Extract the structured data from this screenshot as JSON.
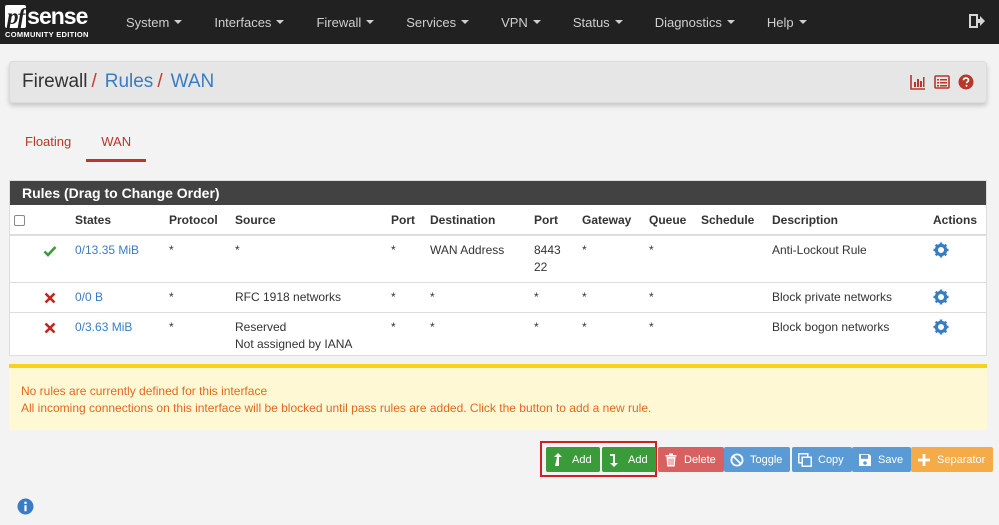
{
  "brand": {
    "logo_pf": "pf",
    "logo_sense": "sense",
    "edition": "COMMUNITY EDITION"
  },
  "nav": [
    {
      "label": "System"
    },
    {
      "label": "Interfaces"
    },
    {
      "label": "Firewall"
    },
    {
      "label": "Services"
    },
    {
      "label": "VPN"
    },
    {
      "label": "Status"
    },
    {
      "label": "Diagnostics"
    },
    {
      "label": "Help"
    }
  ],
  "breadcrumb": {
    "root": "Firewall",
    "section": "Rules",
    "current": "WAN",
    "separator": "/"
  },
  "tabs": [
    {
      "label": "Floating"
    },
    {
      "label": "WAN"
    }
  ],
  "rules": {
    "heading": "Rules (Drag to Change Order)",
    "columns": {
      "states": "States",
      "protocol": "Protocol",
      "source": "Source",
      "port": "Port",
      "destination": "Destination",
      "dport": "Port",
      "gateway": "Gateway",
      "queue": "Queue",
      "schedule": "Schedule",
      "description": "Description",
      "actions": "Actions"
    },
    "rows": [
      {
        "status": "pass",
        "states": "0/13.35 MiB",
        "protocol": "*",
        "source": "*",
        "source2": "",
        "port": "*",
        "destination": "WAN Address",
        "dport": "8443",
        "dport2": "22",
        "gateway": "*",
        "queue": "*",
        "schedule": "",
        "description": "Anti-Lockout Rule"
      },
      {
        "status": "block",
        "states": "0/0 B",
        "protocol": "*",
        "source": "RFC 1918 networks",
        "source2": "",
        "port": "*",
        "destination": "*",
        "dport": "*",
        "dport2": "",
        "gateway": "*",
        "queue": "*",
        "schedule": "",
        "description": "Block private networks"
      },
      {
        "status": "block",
        "states": "0/3.63 MiB",
        "protocol": "*",
        "source": "Reserved",
        "source2": "Not assigned by IANA",
        "port": "*",
        "destination": "*",
        "dport": "*",
        "dport2": "",
        "gateway": "*",
        "queue": "*",
        "schedule": "",
        "description": "Block bogon networks"
      }
    ]
  },
  "alert": {
    "line1": "No rules are currently defined for this interface",
    "line2": "All incoming connections on this interface will be blocked until pass rules are added. Click the button to add a new rule."
  },
  "buttons": {
    "add_top": "Add",
    "add_bottom": "Add",
    "delete": "Delete",
    "toggle": "Toggle",
    "copy": "Copy",
    "save": "Save",
    "separator": "Separator"
  },
  "colors": {
    "navbar": "#212121",
    "link": "#3a7cc3",
    "accent_red": "#b7372b",
    "green": "#3a9b3a",
    "alert_text": "#e2681f",
    "alert_border": "#f7d11c"
  }
}
